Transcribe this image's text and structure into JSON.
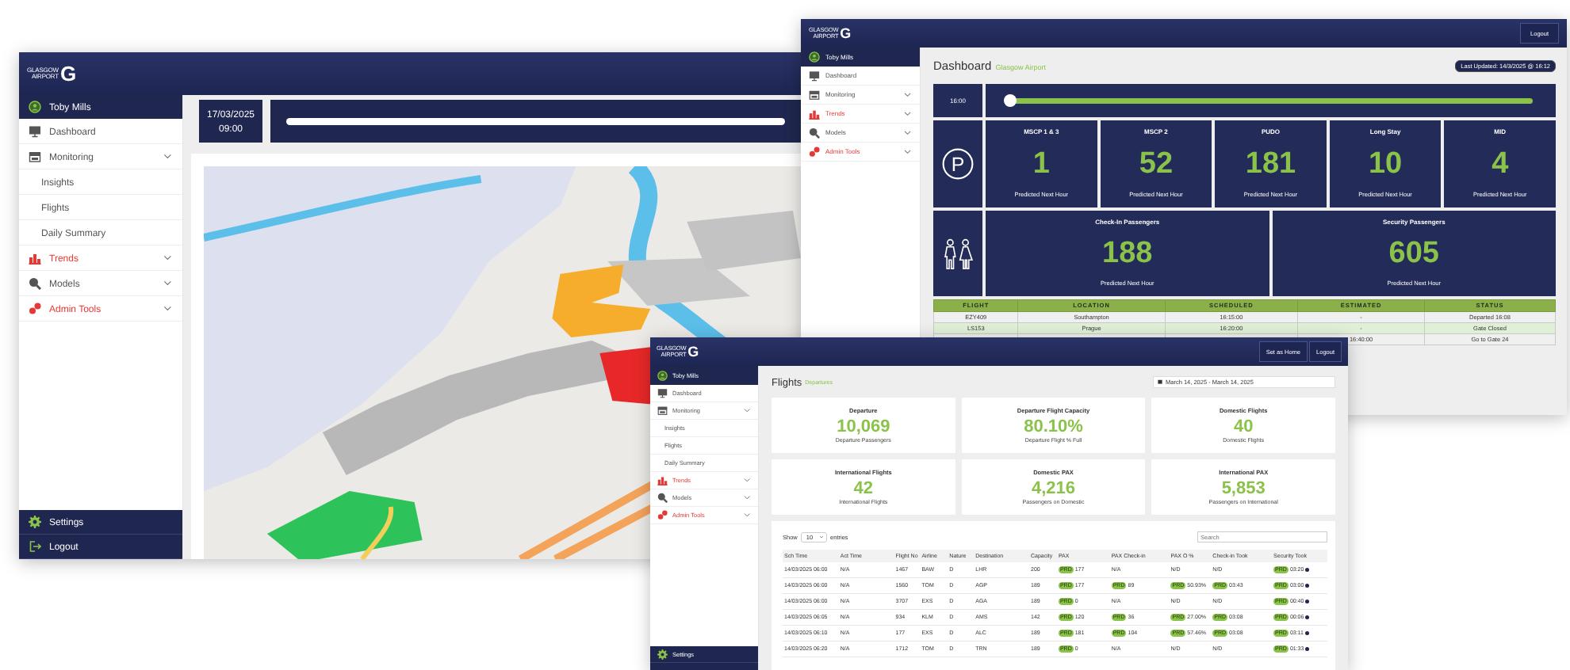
{
  "map_window": {
    "logo": {
      "line1": "GLASGOW",
      "line2": "AIRPORT",
      "mark": "G"
    },
    "user": "Toby Mills",
    "nav": [
      {
        "label": "Dashboard",
        "kind": "link",
        "color": "#555555"
      },
      {
        "label": "Monitoring",
        "kind": "group",
        "color": "#555555",
        "children": [
          {
            "label": "Insights"
          },
          {
            "label": "Flights"
          },
          {
            "label": "Daily Summary"
          }
        ]
      },
      {
        "label": "Trends",
        "kind": "group",
        "color": "#e53935"
      },
      {
        "label": "Models",
        "kind": "group",
        "color": "#555555"
      },
      {
        "label": "Admin Tools",
        "kind": "group",
        "color": "#e53935"
      }
    ],
    "footer": [
      {
        "label": "Settings"
      },
      {
        "label": "Logout"
      }
    ],
    "date": "17/03/2025",
    "time": "09:00"
  },
  "dashboard_window": {
    "logo": {
      "line1": "GLASGOW",
      "line2": "AIRPORT",
      "mark": "G"
    },
    "header_buttons": [
      "Logout"
    ],
    "user": "Toby Mills",
    "nav": [
      {
        "label": "Dashboard",
        "kind": "link",
        "color": "#555555"
      },
      {
        "label": "Monitoring",
        "kind": "group",
        "color": "#555555"
      },
      {
        "label": "Trends",
        "kind": "group",
        "color": "#e53935"
      },
      {
        "label": "Models",
        "kind": "group",
        "color": "#555555"
      },
      {
        "label": "Admin Tools",
        "kind": "group",
        "color": "#e53935"
      }
    ],
    "title": "Dashboard",
    "subtitle": "Glasgow Airport",
    "last_updated": "Last Updated: 14/3/2025 @ 16:12",
    "time": "16:00",
    "timeline": {
      "level": 0
    },
    "parking": {
      "icon": "P",
      "cards": [
        {
          "title": "MSCP 1 & 3",
          "value": "1",
          "caption": "Predicted Next Hour"
        },
        {
          "title": "MSCP 2",
          "value": "52",
          "caption": "Predicted Next Hour"
        },
        {
          "title": "PUDO",
          "value": "181",
          "caption": "Predicted Next Hour"
        },
        {
          "title": "Long Stay",
          "value": "10",
          "caption": "Predicted Next Hour"
        },
        {
          "title": "MID",
          "value": "4",
          "caption": "Predicted Next Hour"
        }
      ]
    },
    "passengers": {
      "cards": [
        {
          "title": "Check-In Passengers",
          "value": "188",
          "caption": "Predicted Next Hour"
        },
        {
          "title": "Security Passengers",
          "value": "605",
          "caption": "Predicted Next Hour"
        }
      ]
    },
    "table": {
      "columns": [
        "FLIGHT",
        "LOCATION",
        "SCHEDULED",
        "ESTIMATED",
        "STATUS"
      ],
      "rows": [
        {
          "highlighted": false,
          "cells": [
            "EZY409",
            "Southampton",
            "16:15:00",
            "-",
            "Departed 16:08"
          ]
        },
        {
          "highlighted": true,
          "cells": [
            "LS153",
            "Prague",
            "16:20:00",
            "-",
            "Gate Closed"
          ]
        },
        {
          "highlighted": false,
          "cells": [
            null,
            null,
            null,
            "16:40:00",
            "Go to Gate 24"
          ]
        }
      ]
    }
  },
  "flights_window": {
    "logo": {
      "line1": "GLASGOW",
      "line2": "AIRPORT",
      "mark": "G"
    },
    "header_buttons": [
      "Set as Home",
      "Logout"
    ],
    "user": "Toby Mills",
    "nav": [
      {
        "label": "Dashboard",
        "kind": "link",
        "color": "#555555"
      },
      {
        "label": "Monitoring",
        "kind": "group",
        "color": "#555555",
        "children": [
          {
            "label": "Insights"
          },
          {
            "label": "Flights"
          },
          {
            "label": "Daily Summary"
          }
        ]
      },
      {
        "label": "Trends",
        "kind": "group",
        "color": "#e53935"
      },
      {
        "label": "Models",
        "kind": "group",
        "color": "#555555"
      },
      {
        "label": "Admin Tools",
        "kind": "group",
        "color": "#e53935"
      }
    ],
    "footer": [
      {
        "label": "Settings"
      }
    ],
    "title": "Flights",
    "subtitle": "Departures",
    "date_range": "March 14, 2025 - March 14, 2025",
    "cards": [
      {
        "title": "Departure",
        "value": "10,069",
        "caption": "Departure Passengers"
      },
      {
        "title": "Departure Flight Capacity",
        "value": "80.10%",
        "caption": "Departure Flight % Full"
      },
      {
        "title": "Domestic Flights",
        "value": "40",
        "caption": "Domestic Flights"
      },
      {
        "title": "International Flights",
        "value": "42",
        "caption": "International Flights"
      },
      {
        "title": "Domestic PAX",
        "value": "4,216",
        "caption": "Passengers on Domestic"
      },
      {
        "title": "International PAX",
        "value": "5,853",
        "caption": "Passengers on International"
      }
    ],
    "table": {
      "show_label": "Show",
      "page_size": "10",
      "entries_label": "entries",
      "search": {
        "placeholder": "Search"
      },
      "columns": [
        "Sch Time",
        "Act Time",
        "Flight No",
        "Airline",
        "Nature",
        "Destination",
        "Capacity",
        "PAX",
        "PAX Check-in",
        "PAX O %",
        "Check-in Took",
        "Security Took"
      ],
      "rows": [
        {
          "cells": [
            "14/03/2025 06:00",
            "N/A",
            "1467",
            "BAW",
            "D",
            "LHR",
            "200",
            {
              "badge": "PRD",
              "value": "177"
            },
            "N/A",
            "N/D",
            "N/D",
            {
              "badge": "PRD",
              "value": "03:20"
            }
          ]
        },
        {
          "cells": [
            "14/03/2025 06:00",
            "N/A",
            "1560",
            "TOM",
            "D",
            "AGP",
            "189",
            {
              "badge": "PRD",
              "value": "177"
            },
            {
              "badge": "PRD",
              "value": "89"
            },
            {
              "badge": "PRD",
              "value": "50.93%"
            },
            {
              "badge": "PRD",
              "value": "03:43"
            },
            {
              "badge": "PRD",
              "value": "03:00"
            }
          ]
        },
        {
          "cells": [
            "14/03/2025 06:00",
            "N/A",
            "3707",
            "EXS",
            "D",
            "AGA",
            "189",
            {
              "badge": "PRD",
              "value": "0"
            },
            "N/A",
            "N/D",
            "N/D",
            {
              "badge": "PRD",
              "value": "00:40"
            }
          ]
        },
        {
          "cells": [
            "14/03/2025 06:05",
            "N/A",
            "934",
            "KLM",
            "D",
            "AMS",
            "142",
            {
              "badge": "PRD",
              "value": "120"
            },
            {
              "badge": "PRD",
              "value": "36"
            },
            {
              "badge": "PRD",
              "value": "27.00%"
            },
            {
              "badge": "PRD",
              "value": "03:08"
            },
            {
              "badge": "PRD",
              "value": "00:06"
            }
          ]
        },
        {
          "cells": [
            "14/03/2025 06:10",
            "N/A",
            "177",
            "EXS",
            "D",
            "ALC",
            "189",
            {
              "badge": "PRD",
              "value": "181"
            },
            {
              "badge": "PRD",
              "value": "104"
            },
            {
              "badge": "PRD",
              "value": "57.46%"
            },
            {
              "badge": "PRD",
              "value": "03:08"
            },
            {
              "badge": "PRD",
              "value": "03:11"
            }
          ]
        },
        {
          "cells": [
            "14/03/2025 06:20",
            "N/A",
            "1712",
            "TOM",
            "D",
            "TRN",
            "189",
            {
              "badge": "PRD",
              "value": "0"
            },
            "N/A",
            "N/D",
            "N/D",
            {
              "badge": "PRD",
              "value": "01:33"
            }
          ]
        }
      ]
    }
  }
}
